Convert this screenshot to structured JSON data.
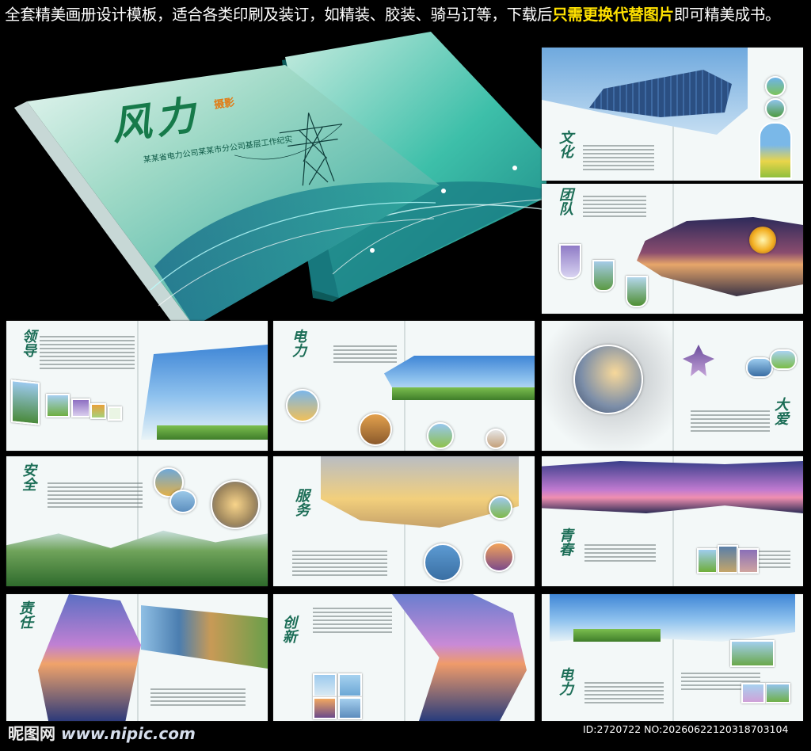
{
  "banner": {
    "part1": "全套精美画册设计模板，适合各类印刷及装订，如精装、胶装、骑马订等，下载后",
    "highlight": "只需更换代替图片",
    "part2": "即可精美成书。"
  },
  "cover": {
    "title": "风力",
    "tag": "摄影",
    "subtitle": "某某省电力公司某某市分公司基层工作纪实"
  },
  "spreads": [
    {
      "calligraphy": "文化",
      "index": 1
    },
    {
      "calligraphy": "团队",
      "index": 2
    },
    {
      "calligraphy": "领导",
      "index": 3
    },
    {
      "calligraphy": "电力",
      "index": 4
    },
    {
      "calligraphy": "大爱",
      "index": 5
    },
    {
      "calligraphy": "安全",
      "index": 6
    },
    {
      "calligraphy": "服务",
      "index": 7
    },
    {
      "calligraphy": "青春",
      "index": 8
    },
    {
      "calligraphy": "责任",
      "index": 9
    },
    {
      "calligraphy": "创新",
      "index": 10
    },
    {
      "calligraphy": "电力",
      "index": 11
    }
  ],
  "colors": {
    "background": "#000000",
    "banner_text": "#ffffff",
    "banner_highlight": "#ffe100",
    "cover_teal": "#2cb3a0",
    "calligraphy_green": "#1b6d56"
  },
  "watermark": {
    "site": "昵图网",
    "url": "www.nipic.com",
    "id": "ID:2720722 NO:20260622120318703104"
  }
}
